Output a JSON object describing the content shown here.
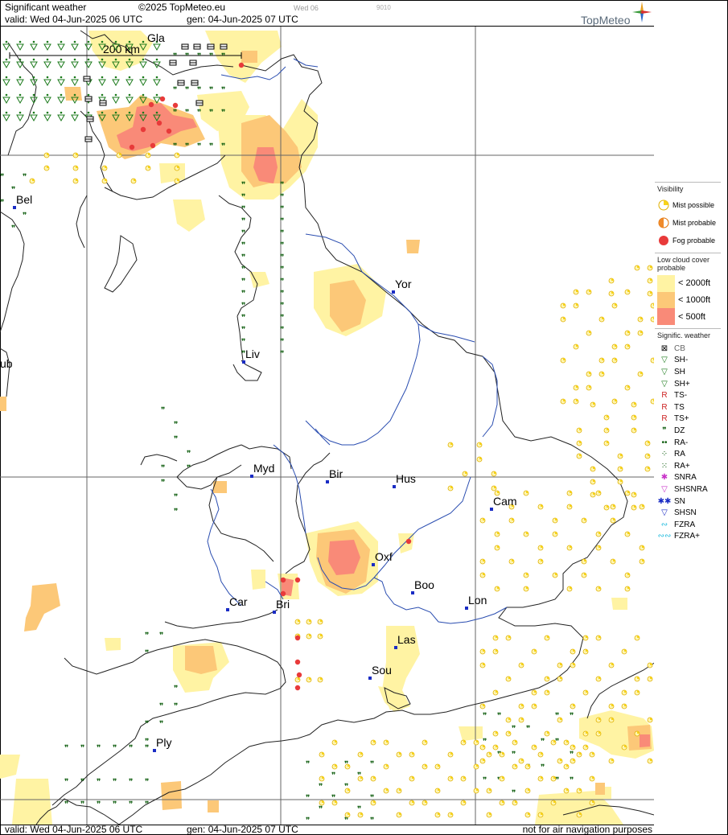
{
  "header": {
    "title": "Significant weather",
    "copyright": "©2025 TopMeteo.eu",
    "valid": "valid:  Wed  04-Jun-2025  06 UTC",
    "gen": "gen: 04-Jun-2025 07 UTC",
    "tiny1": "Wed 06",
    "tiny2": "9010",
    "logo": "TopMeteo"
  },
  "map": {
    "scale_label": "200 km",
    "cities": [
      "Gla",
      "Bel",
      "Yor",
      "Liv",
      "ub",
      "Myd",
      "Bir",
      "Hus",
      "Cam",
      "Oxf",
      "Boo",
      "Lon",
      "Car",
      "Bri",
      "Las",
      "Sou",
      "Ply"
    ]
  },
  "footer": {
    "valid": "valid:  Wed  04-Jun-2025  06 UTC",
    "gen": "gen: 04-Jun-2025 07 UTC",
    "note": "not for air navigation purposes"
  },
  "legend": {
    "visibility_title": "Visibility",
    "visibility": [
      {
        "label": "Mist possible",
        "color": "#f7d31a"
      },
      {
        "label": "Mist probable",
        "color": "#f08a2a"
      },
      {
        "label": "Fog probable",
        "color": "#e83a3a"
      }
    ],
    "cloud_title": "Low cloud cover probable",
    "cloud": [
      {
        "label": "< 2000ft",
        "color": "#fff3a3"
      },
      {
        "label": "< 1000ft",
        "color": "#fcc878"
      },
      {
        "label": "<   500ft",
        "color": "#f98a78"
      }
    ],
    "weather_title": "Signific. weather",
    "weather": [
      {
        "sym": "⊠",
        "label": "CB",
        "color": "#000000"
      },
      {
        "sym": "▽",
        "label": "SH-",
        "color": "#1b7a1b"
      },
      {
        "sym": "▽",
        "label": "SH",
        "color": "#1b7a1b"
      },
      {
        "sym": "▽",
        "label": "SH+",
        "color": "#1b7a1b"
      },
      {
        "sym": "R",
        "label": "TS-",
        "color": "#cc2222"
      },
      {
        "sym": "R",
        "label": "TS",
        "color": "#cc2222"
      },
      {
        "sym": "R",
        "label": "TS+",
        "color": "#cc2222"
      },
      {
        "sym": "❞",
        "label": "DZ",
        "color": "#0a5a0a"
      },
      {
        "sym": "••",
        "label": "RA-",
        "color": "#0a5a0a"
      },
      {
        "sym": "⁘",
        "label": "RA",
        "color": "#0a5a0a"
      },
      {
        "sym": "⁙",
        "label": "RA+",
        "color": "#0a5a0a"
      },
      {
        "sym": "✱",
        "label": "SNRA",
        "color": "#c832c8"
      },
      {
        "sym": "▽",
        "label": "SHSNRA",
        "color": "#c832c8"
      },
      {
        "sym": "✱✱",
        "label": "SN",
        "color": "#1a2cc4"
      },
      {
        "sym": "▽",
        "label": "SHSN",
        "color": "#1a2cc4"
      },
      {
        "sym": "∾",
        "label": "FZRA",
        "color": "#22bbdd"
      },
      {
        "sym": "∾∾",
        "label": "FZRA+",
        "color": "#22bbdd"
      }
    ]
  }
}
